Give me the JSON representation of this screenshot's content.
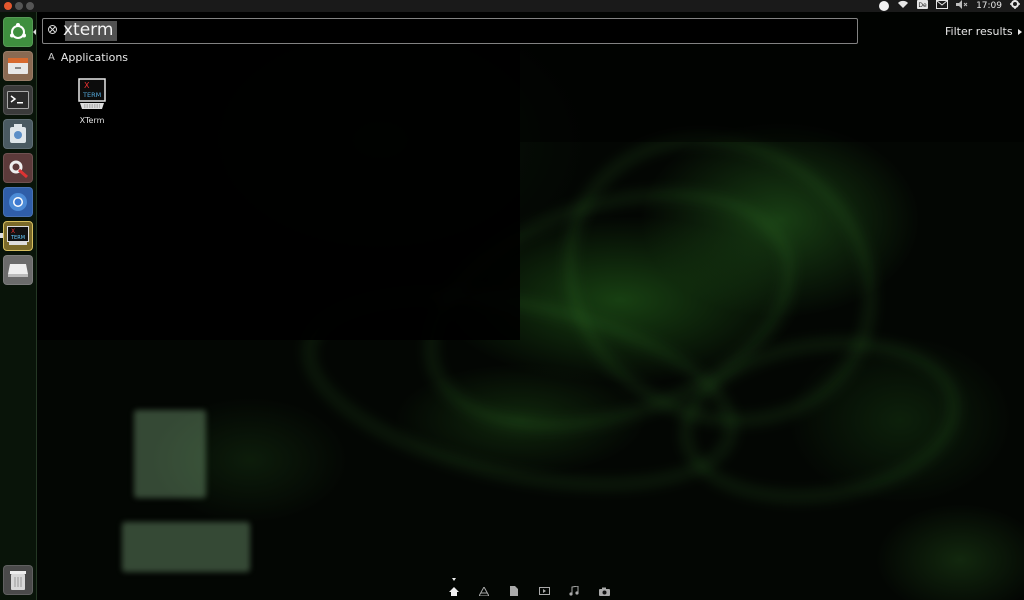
{
  "top_panel": {
    "clock": "17:09"
  },
  "launcher": {
    "items": [
      {
        "name": "dash-home",
        "icon": "ubuntu-logo-icon"
      },
      {
        "name": "files",
        "icon": "file-manager-icon"
      },
      {
        "name": "terminal",
        "icon": "terminal-icon"
      },
      {
        "name": "screenshot",
        "icon": "camera-icon"
      },
      {
        "name": "system-settings",
        "icon": "settings-icon"
      },
      {
        "name": "chromium",
        "icon": "chromium-icon"
      },
      {
        "name": "xterm",
        "icon": "xterm-icon"
      },
      {
        "name": "drive",
        "icon": "drive-icon"
      },
      {
        "name": "trash",
        "icon": "trash-icon"
      }
    ]
  },
  "search": {
    "value": "xterm"
  },
  "filter": {
    "label": "Filter results"
  },
  "results": {
    "category_label": "Applications",
    "items": [
      {
        "label": "XTerm",
        "icon_text_top": "X",
        "icon_text_bottom": "TERM"
      }
    ]
  },
  "lens_bar": {
    "lenses": [
      "home-icon",
      "applications-icon",
      "files-icon",
      "video-icon",
      "music-icon",
      "photos-icon"
    ],
    "active": "home-icon"
  },
  "colors": {
    "launcher_home_bg": "#3f8f3f",
    "selection_bg": "#969696"
  }
}
